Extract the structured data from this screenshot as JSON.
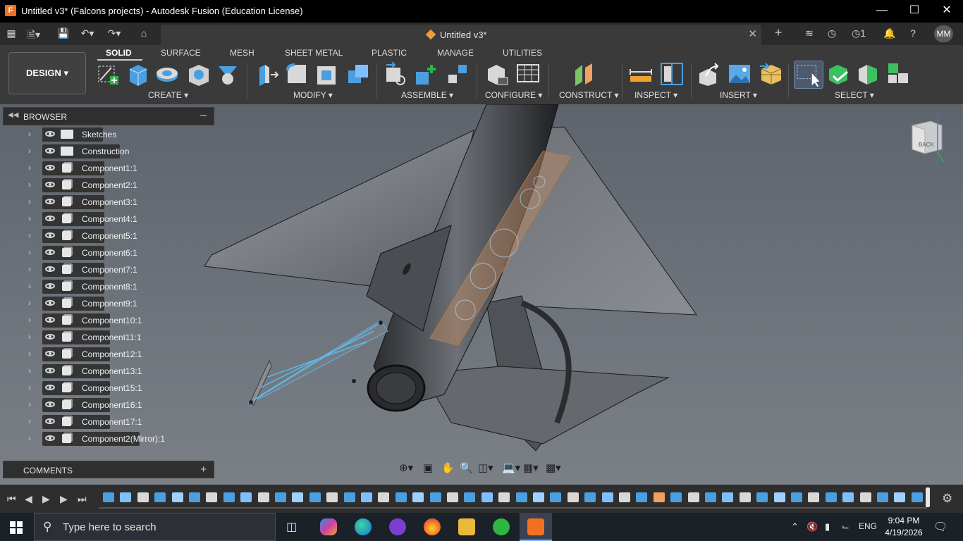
{
  "window": {
    "title": "Untitled v3* (Falcons projects) - Autodesk Fusion (Education License)",
    "app_icon_letter": "F",
    "controls": [
      "minimize",
      "maximize",
      "close"
    ]
  },
  "tabbar": {
    "document_tab": "Untitled v3*",
    "job_count": "1",
    "user_initials": "MM"
  },
  "ribbon": {
    "workspace": "DESIGN",
    "tabs": [
      "SOLID",
      "SURFACE",
      "MESH",
      "SHEET METAL",
      "PLASTIC",
      "MANAGE",
      "UTILITIES"
    ],
    "active_tab": "SOLID",
    "groups": [
      "CREATE",
      "MODIFY",
      "ASSEMBLE",
      "CONFIGURE",
      "CONSTRUCT",
      "INSPECT",
      "INSERT",
      "SELECT"
    ]
  },
  "browser": {
    "title": "BROWSER",
    "items": [
      {
        "label": "Sketches",
        "type": "folder"
      },
      {
        "label": "Construction",
        "type": "folder"
      },
      {
        "label": "Component1:1",
        "type": "component"
      },
      {
        "label": "Component2:1",
        "type": "component"
      },
      {
        "label": "Component3:1",
        "type": "component"
      },
      {
        "label": "Component4:1",
        "type": "component"
      },
      {
        "label": "Component5:1",
        "type": "component"
      },
      {
        "label": "Component6:1",
        "type": "component"
      },
      {
        "label": "Component7:1",
        "type": "component"
      },
      {
        "label": "Component8:1",
        "type": "component"
      },
      {
        "label": "Component9:1",
        "type": "component"
      },
      {
        "label": "Component10:1",
        "type": "component"
      },
      {
        "label": "Component11:1",
        "type": "component"
      },
      {
        "label": "Component12:1",
        "type": "component"
      },
      {
        "label": "Component13:1",
        "type": "component"
      },
      {
        "label": "Component15:1",
        "type": "component"
      },
      {
        "label": "Component16:1",
        "type": "component"
      },
      {
        "label": "Component17:1",
        "type": "component"
      },
      {
        "label": "Component2(Mirror):1",
        "type": "component"
      }
    ]
  },
  "comments": {
    "title": "COMMENTS"
  },
  "viewcube": {
    "face": "BACK"
  },
  "taskbar": {
    "search_placeholder": "Type here to search",
    "language": "ENG",
    "time": "9:04 PM",
    "date": "4/19/2026"
  },
  "colors": {
    "accent_orange": "#f37021",
    "ribbon_bg": "#3a3a3a",
    "viewport_top": "#5e646c",
    "viewport_bottom": "#7b8087",
    "taskbar_bg": "#1b2129"
  }
}
